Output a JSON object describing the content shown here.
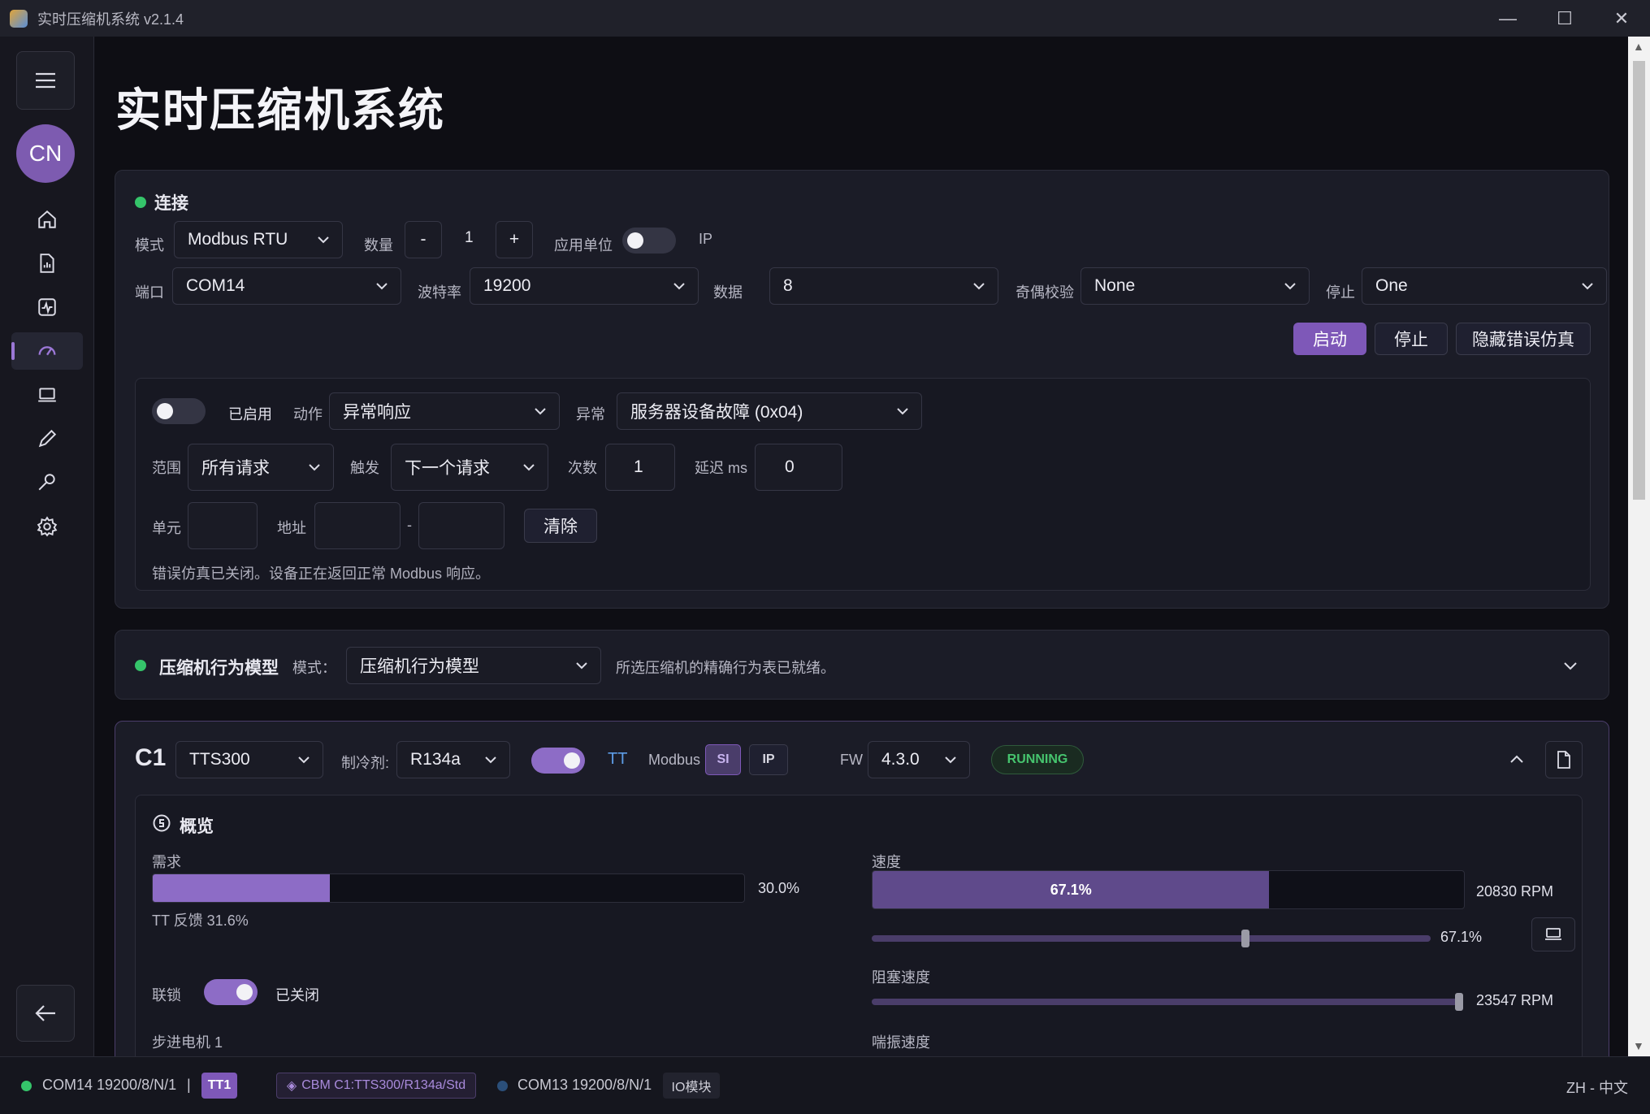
{
  "window": {
    "title": "实时压缩机系统 v2.1.4",
    "minimize": "—",
    "maximize": "☐",
    "close": "✕"
  },
  "page": {
    "title": "实时压缩机系统"
  },
  "sidebar": {
    "avatar": "CN"
  },
  "connection": {
    "title": "连接",
    "mode_label": "模式",
    "mode_value": "Modbus RTU",
    "count_label": "数量",
    "count_minus": "-",
    "count_value": "1",
    "count_plus": "+",
    "unit_label": "应用单位",
    "ip_label": "IP",
    "port_label": "端口",
    "port_value": "COM14",
    "baud_label": "波特率",
    "baud_value": "19200",
    "data_label": "数据",
    "data_value": "8",
    "parity_label": "奇偶校验",
    "parity_value": "None",
    "stop_label": "停止",
    "stop_value": "One",
    "start_btn": "启动",
    "stop_btn": "停止",
    "hide_btn": "隐藏错误仿真"
  },
  "error_sim": {
    "enabled_label": "已启用",
    "action_label": "动作",
    "action_value": "异常响应",
    "exception_label": "异常",
    "exception_value": "服务器设备故障 (0x04)",
    "scope_label": "范围",
    "scope_value": "所有请求",
    "trigger_label": "触发",
    "trigger_value": "下一个请求",
    "times_label": "次数",
    "times_value": "1",
    "delay_label": "延迟 ms",
    "delay_value": "0",
    "unit_label": "单元",
    "unit_value": "",
    "addr_label": "地址",
    "addr_from": "",
    "addr_sep": "-",
    "addr_to": "",
    "clear_btn": "清除",
    "status": "错误仿真已关闭。设备正在返回正常 Modbus 响应。"
  },
  "behavior": {
    "title": "压缩机行为模型",
    "mode_label": "模式：",
    "mode_value": "压缩机行为模型",
    "status": "所选压缩机的精确行为表已就绪。"
  },
  "compressor": {
    "id": "C1",
    "model": "TTS300",
    "refrigerant_label": "制冷剂:",
    "refrigerant": "R134a",
    "tt_label": "TT",
    "modbus_label": "Modbus",
    "si_tag": "SI",
    "ip_tag": "IP",
    "fw_label": "FW",
    "fw_value": "4.3.0",
    "state": "RUNNING",
    "overview_title": "概览",
    "demand_label": "需求",
    "demand_value": "30.0%",
    "demand_pct": 30.0,
    "tt_feedback": "TT 反馈 31.6%",
    "speed_label": "速度",
    "speed_bar_value": "67.1%",
    "speed_pct": 67.1,
    "speed_rpm": "20830 RPM",
    "speed_slider_value": "67.1%",
    "speed_slider_pct": 67.1,
    "choke_label": "阻塞速度",
    "choke_rpm": "23547 RPM",
    "choke_slider_pct": 100,
    "interlock_label": "联锁",
    "interlock_state": "已关闭",
    "stepper_label": "步进电机 1",
    "surge_label": "喘振速度"
  },
  "statusbar": {
    "port1": "COM14 19200/8/N/1",
    "sep": "|",
    "tt_tag": "TT1",
    "cbm_tag": "CBM C1:TTS300/R134a/Std",
    "port2": "COM13 19200/8/N/1",
    "io_tag": "IO模块",
    "lang": "ZH - 中文"
  },
  "colors": {
    "accent": "#7e58b8",
    "ok": "#35c46a",
    "port2_dot": "#2b4f7a"
  }
}
